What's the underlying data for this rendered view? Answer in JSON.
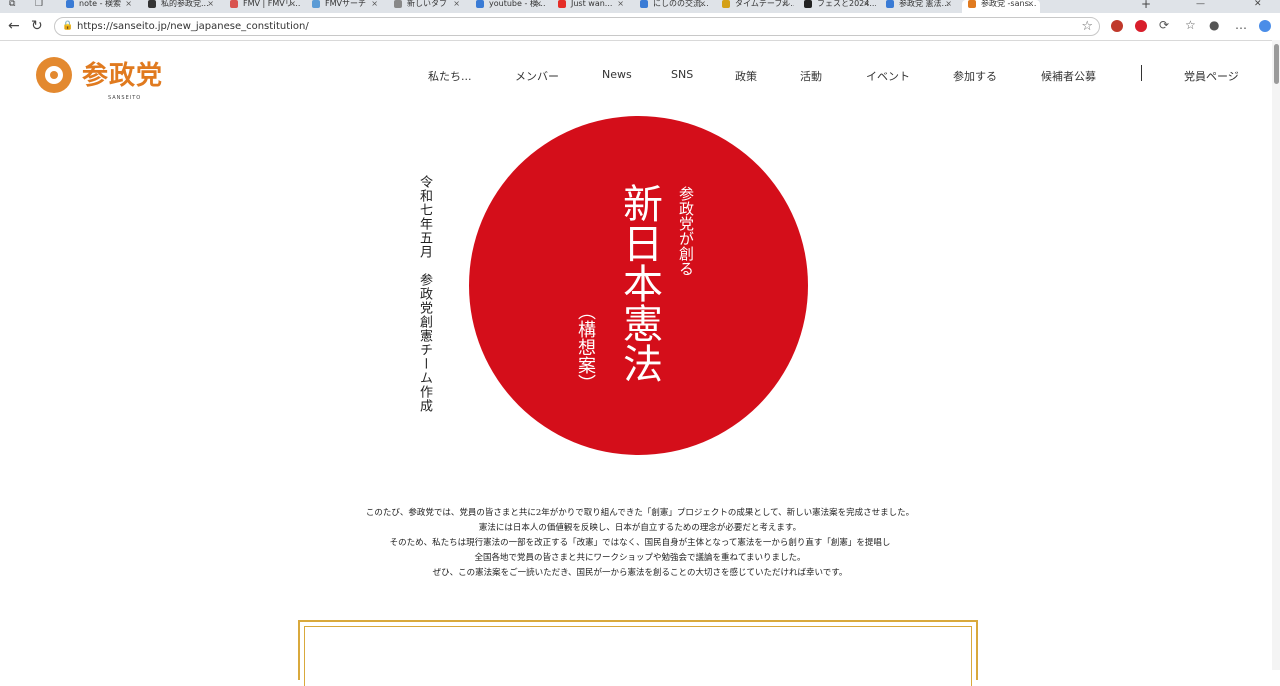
{
  "browser": {
    "tabs": [
      {
        "label": "note - 検索",
        "color": "#3a7bd5"
      },
      {
        "label": "私的参政党...",
        "color": "#333333"
      },
      {
        "label": "FMV | FMVリ...",
        "color": "#d9534f"
      },
      {
        "label": "FMVサーチ",
        "color": "#5b9bd5"
      },
      {
        "label": "新しいタブ",
        "color": "#888888"
      },
      {
        "label": "youtube - 検...",
        "color": "#3a7bd5"
      },
      {
        "label": "Just wan...",
        "color": "#e52d27"
      },
      {
        "label": "にしのの交流...",
        "color": "#3a7bd5"
      },
      {
        "label": "タイムテーブル...",
        "color": "#d4a017"
      },
      {
        "label": "フェスと2024...",
        "color": "#222222"
      },
      {
        "label": "参政党 憲法...",
        "color": "#3a7bd5"
      },
      {
        "label": "参政党 -sans...",
        "color": "#e07a1f"
      }
    ],
    "url": "https://sanseito.jp/new_japanese_constitution/",
    "accent": "#e07a1f"
  },
  "site": {
    "logo_text": "参政党",
    "logo_sub": "SANSEITO",
    "nav": [
      "私たち...",
      "メンバー",
      "News",
      "SNS",
      "政策",
      "活動",
      "イベント",
      "参加する",
      "候補者公募",
      "党員ページ"
    ]
  },
  "hero": {
    "date_line": "令和七年五月　参政党創憲チーム作成",
    "subtitle": "参政党が創る",
    "title": "新日本憲法",
    "note": "（構想案）",
    "circle_color": "#d40e1a"
  },
  "intro": {
    "lines": [
      "このたび、参政党では、党員の皆さまと共に2年がかりで取り組んできた「創憲」プロジェクトの成果として、新しい憲法案を完成させました。",
      "憲法には日本人の価値観を反映し、日本が自立するための理念が必要だと考えます。",
      "そのため、私たちは現行憲法の一部を改正する「改憲」ではなく、国民自身が主体となって憲法を一から創り直す「創憲」を提唱し",
      "全国各地で党員の皆さまと共にワークショップや勉強会で議論を重ねてまいりました。",
      "ぜひ、この憲法案をご一読いただき、国民が一から憲法を創ることの大切さを感じていただければ幸いです。"
    ]
  }
}
